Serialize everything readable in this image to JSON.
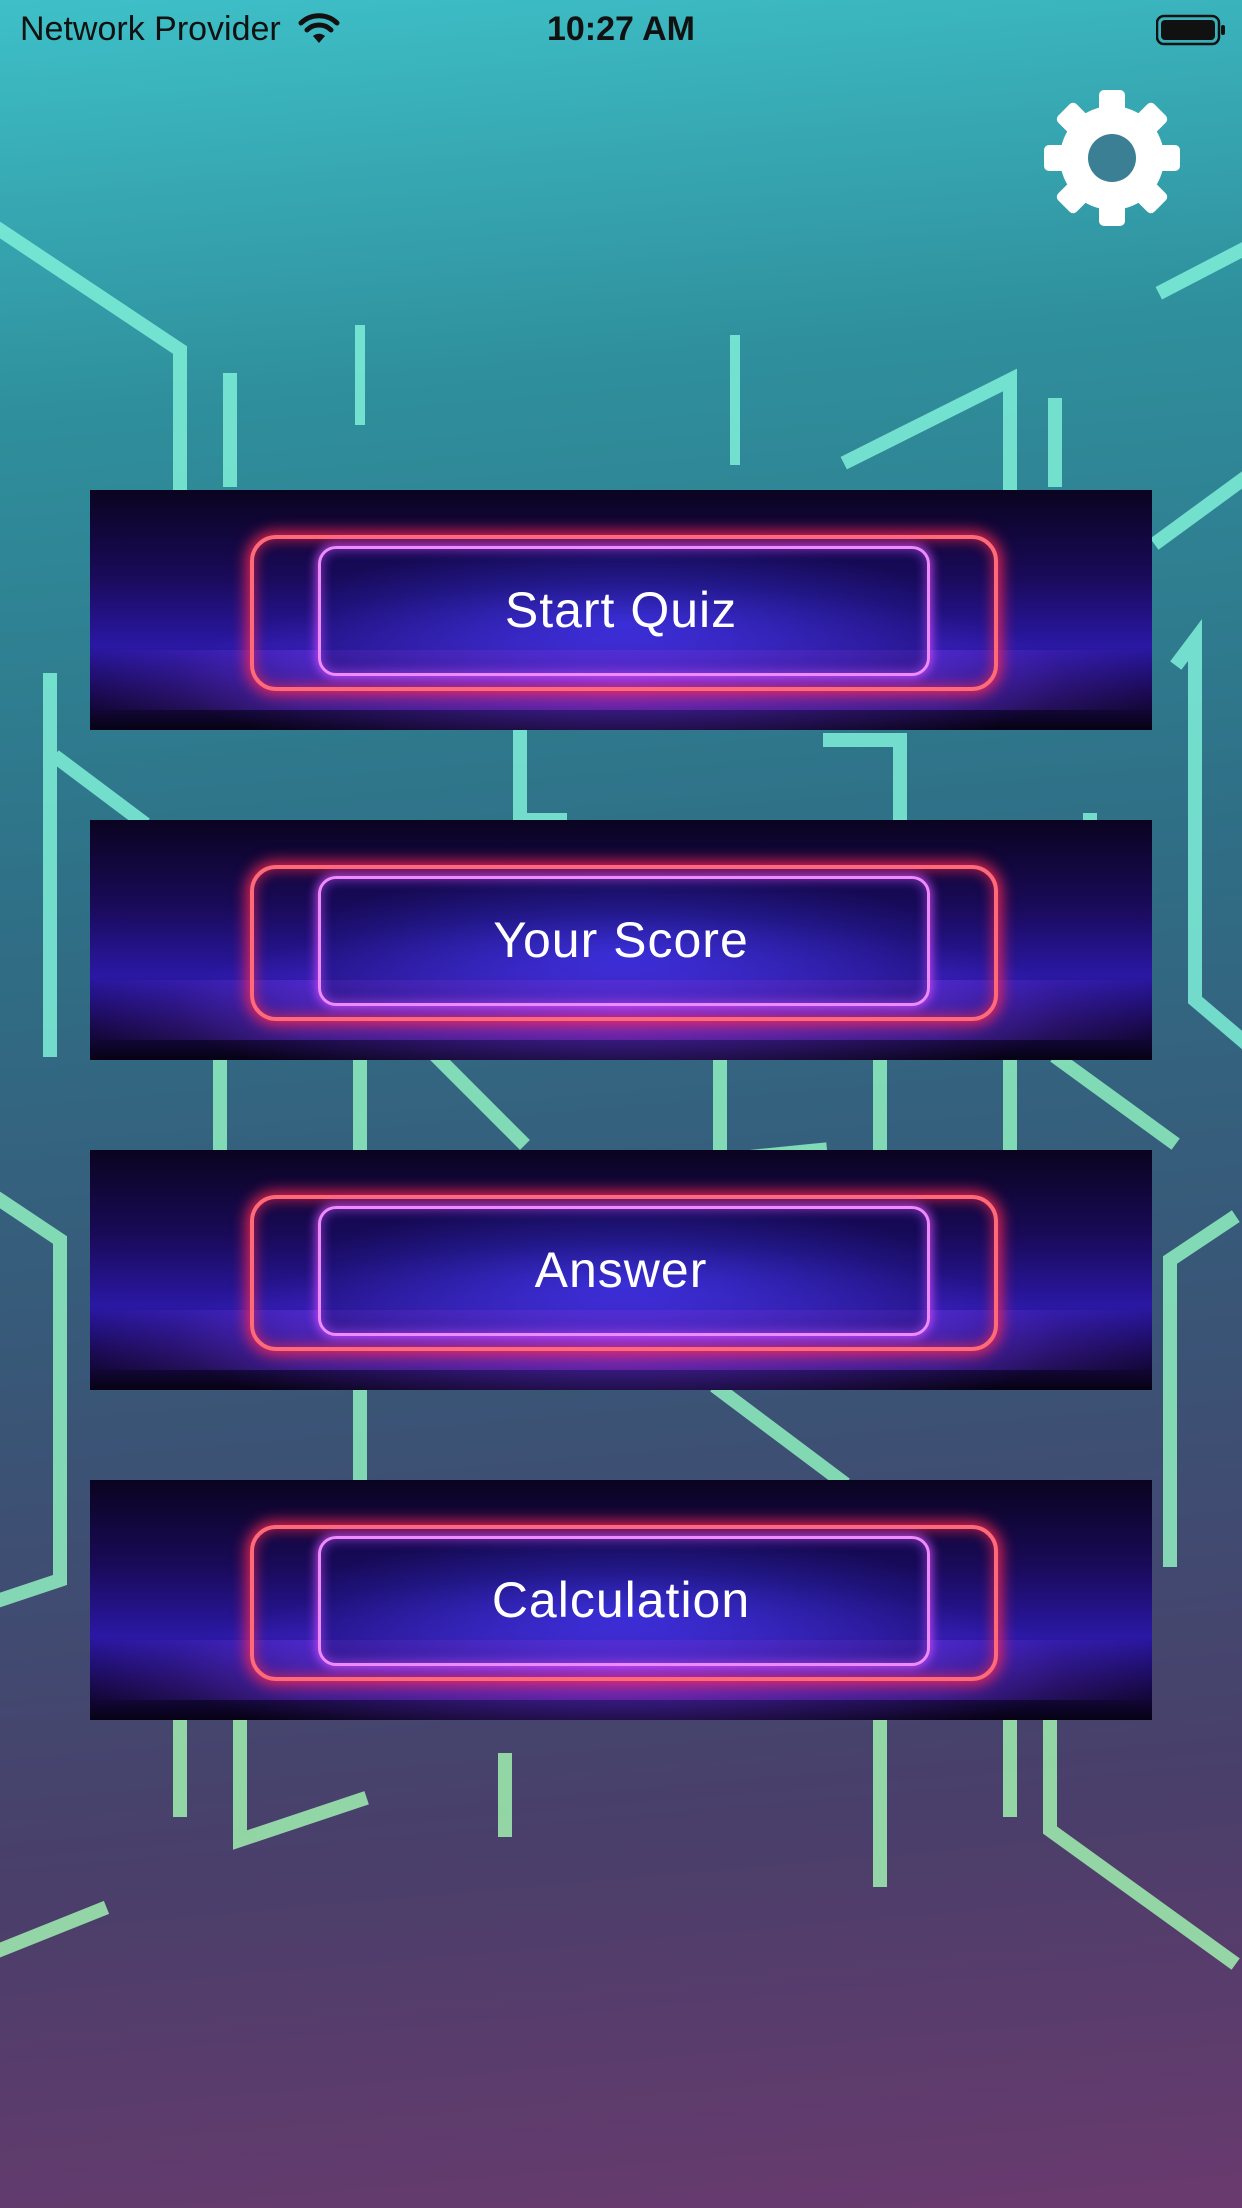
{
  "status_bar": {
    "carrier": "Network Provider",
    "time": "10:27 AM",
    "wifi_icon": "wifi-icon",
    "battery_icon": "battery-icon"
  },
  "settings": {
    "icon": "gear-icon"
  },
  "menu": {
    "items": [
      {
        "label": "Start Quiz"
      },
      {
        "label": "Your Score"
      },
      {
        "label": "Answer"
      },
      {
        "label": "Calculation"
      }
    ]
  },
  "colors": {
    "neon_red": "#ff6a78",
    "neon_pink": "#f08bff",
    "line_mint": "#7ff0c8"
  }
}
